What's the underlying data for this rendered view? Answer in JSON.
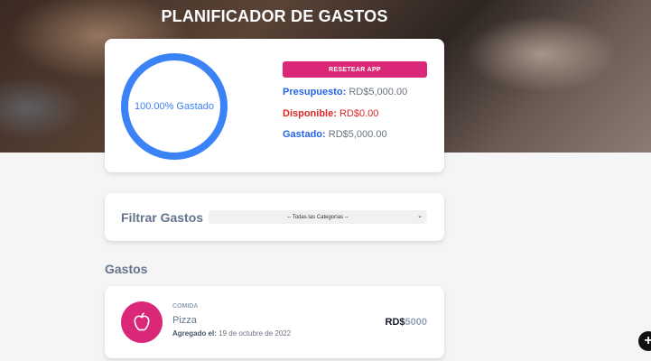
{
  "header": {
    "title": "PLANIFICADOR DE GASTOS"
  },
  "budget": {
    "percent_label": "100.00% Gastado",
    "percent_spent": 100,
    "reset_label": "RESETEAR APP",
    "budget_label": "Presupuesto:",
    "budget_value": "RD$5,000.00",
    "available_label": "Disponible:",
    "available_value": "RD$0.00",
    "spent_label": "Gastado:",
    "spent_value": "RD$5,000.00"
  },
  "filter": {
    "label": "Filtrar Gastos",
    "selected": "-- Todas las Categorías --"
  },
  "expenses": {
    "title": "Gastos",
    "items": [
      {
        "category": "COMIDA",
        "name": "Pizza",
        "date_label": "Agregado el:",
        "date": "19 de octubre de 2022",
        "currency": "RD$",
        "amount": "5000",
        "icon": "apple-icon"
      }
    ]
  },
  "colors": {
    "accent": "#3b82f6",
    "pink": "#db2777",
    "danger": "#dc2626"
  },
  "fab": {
    "icon": "plus-icon"
  }
}
